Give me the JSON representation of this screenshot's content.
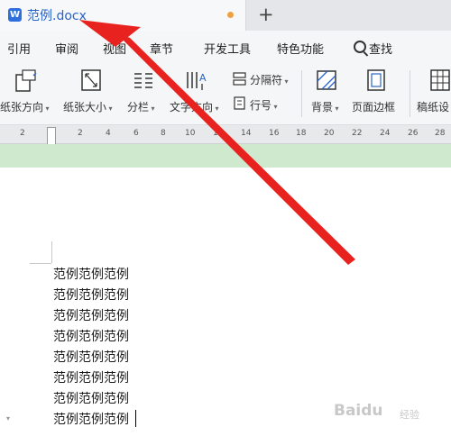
{
  "tab": {
    "title": "范例.docx",
    "app_badge": "W",
    "new_tab": "+"
  },
  "menu": {
    "items": [
      "引用",
      "审阅",
      "视图",
      "章节",
      "开发工具",
      "特色功能"
    ],
    "search_label": "查找"
  },
  "ribbon": {
    "paper_orientation": "纸张方向",
    "paper_size": "纸张大小",
    "columns": "分栏",
    "text_direction": "文字方向",
    "separator": "分隔符",
    "line_number": "行号",
    "background": "背景",
    "page_border": "页面边框",
    "manuscript": "稿纸设"
  },
  "ruler": {
    "ticks": [
      "2",
      "2",
      "4",
      "6",
      "8",
      "10",
      "12",
      "14",
      "16",
      "18",
      "20",
      "22",
      "24",
      "26",
      "28"
    ]
  },
  "document": {
    "lines": [
      "范例范例范例",
      "范例范例范例",
      "范例范例范例",
      "范例范例范例",
      "范例范例范例",
      "范例范例范例",
      "范例范例范例",
      "范例范例范例"
    ]
  },
  "watermark": {
    "brand": "Baidu",
    "sub": "经验"
  },
  "annotation": {
    "arrow_color": "#e8231f"
  },
  "colors": {
    "accent": "#2a63c9",
    "unsaved_dot": "#f0a040",
    "page_band": "#cfe9cf"
  }
}
